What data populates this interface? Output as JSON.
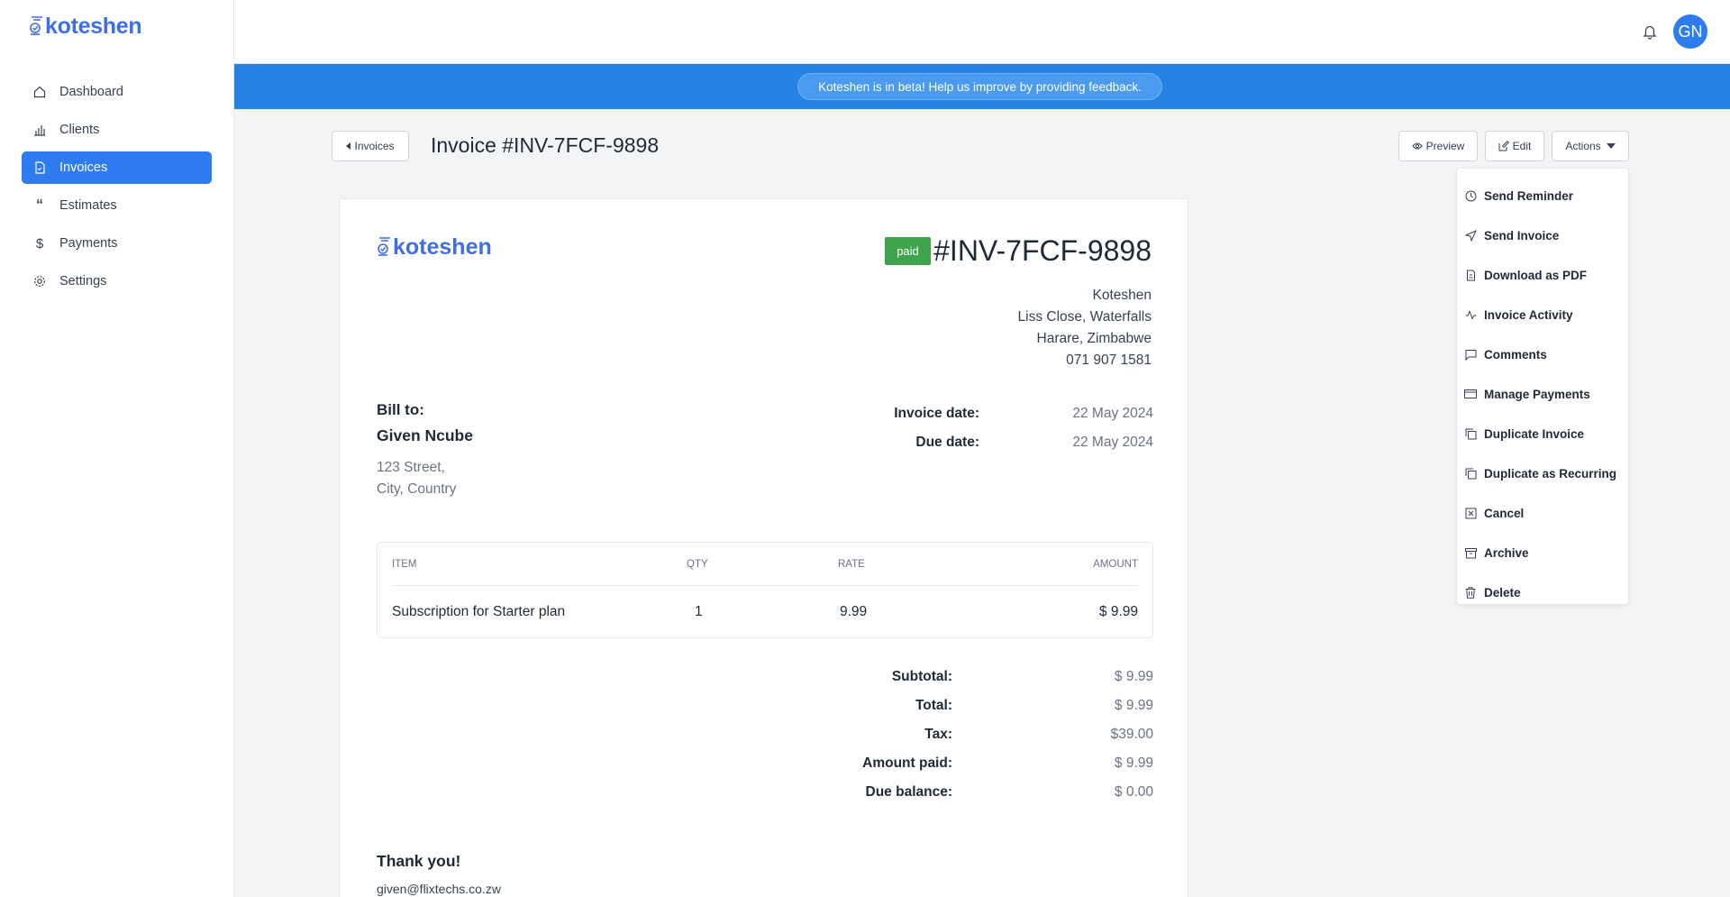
{
  "app": {
    "logo_text": "koteshen"
  },
  "sidebar": {
    "items": [
      {
        "label": "Dashboard",
        "icon": "home-icon"
      },
      {
        "label": "Clients",
        "icon": "chart-icon"
      },
      {
        "label": "Invoices",
        "icon": "document-icon",
        "active": true
      },
      {
        "label": "Estimates",
        "icon": "quote-icon"
      },
      {
        "label": "Payments",
        "icon": "dollar-icon"
      },
      {
        "label": "Settings",
        "icon": "gear-icon"
      }
    ]
  },
  "header": {
    "avatar_initials": "GN"
  },
  "banner": {
    "text": "Koteshen is in beta! Help us improve by providing feedback."
  },
  "page": {
    "back_label": "Invoices",
    "title": "Invoice #INV-7FCF-9898",
    "preview_label": "Preview",
    "edit_label": "Edit",
    "actions_label": "Actions"
  },
  "actions_menu": [
    "Send Reminder",
    "Send Invoice",
    "Download as PDF",
    "Invoice Activity",
    "Comments",
    "Manage Payments",
    "Duplicate Invoice",
    "Duplicate as Recurring",
    "Cancel",
    "Archive",
    "Delete"
  ],
  "invoice": {
    "status": "paid",
    "number": "#INV-7FCF-9898",
    "company": {
      "name": "Koteshen",
      "line1": "Liss Close, Waterfalls",
      "line2": "Harare, Zimbabwe",
      "phone": "071 907 1581"
    },
    "bill_to_label": "Bill to:",
    "client_name": "Given Ncube",
    "client_line1": "123 Street,",
    "client_line2": "City, Country",
    "invoice_date_label": "Invoice date:",
    "invoice_date": "22 May 2024",
    "due_date_label": "Due date:",
    "due_date": "22 May 2024",
    "columns": {
      "item": "ITEM",
      "qty": "QTY",
      "rate": "RATE",
      "amount": "AMOUNT"
    },
    "line_items": [
      {
        "item": "Subscription for Starter plan",
        "qty": "1",
        "rate": "9.99",
        "amount": "$ 9.99"
      }
    ],
    "totals": {
      "subtotal_label": "Subtotal:",
      "subtotal": "$ 9.99",
      "total_label": "Total:",
      "total": "$ 9.99",
      "tax_label": "Tax:",
      "tax": "$39.00",
      "paid_label": "Amount paid:",
      "paid": "$ 9.99",
      "due_label": "Due balance:",
      "due": "$ 0.00"
    },
    "thanks": "Thank you!",
    "email": "given@flixtechs.co.zw"
  },
  "colors": {
    "primary": "#2f7cf1",
    "banner": "#2583e4",
    "paid": "#3fa34d",
    "brand": "#3f6fe6"
  }
}
